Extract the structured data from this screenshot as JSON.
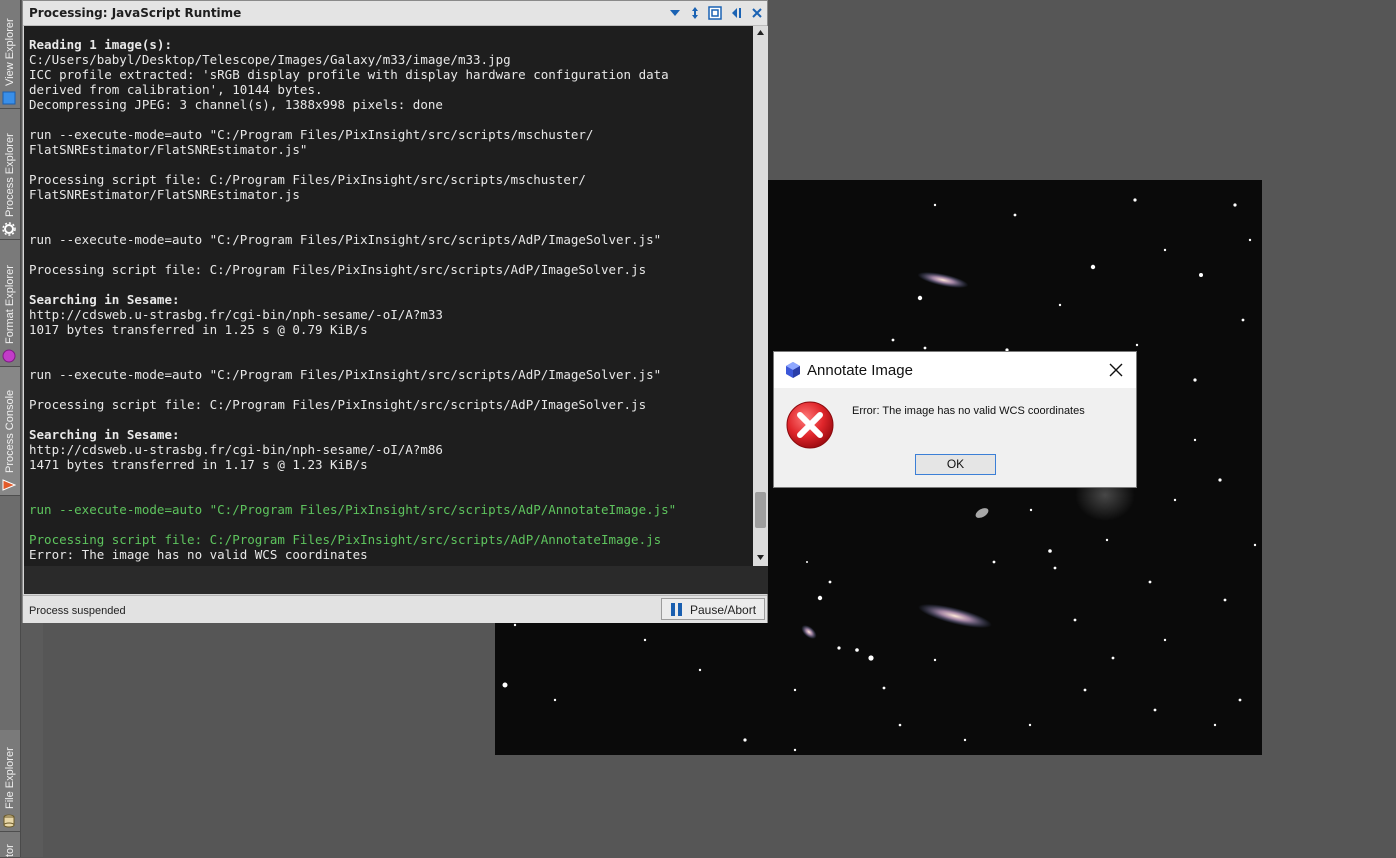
{
  "side_tabs": [
    {
      "label": "View Explorer",
      "icon": "view-explorer-square-icon"
    },
    {
      "label": "Process Explorer",
      "icon": "gear-icon"
    },
    {
      "label": "Format Explorer",
      "icon": "format-circle-icon"
    },
    {
      "label": "Process Console",
      "icon": "console-triangle-icon"
    },
    {
      "label": "File Explorer",
      "icon": "file-cylinder-icon"
    },
    {
      "label": "tor",
      "icon": ""
    }
  ],
  "console": {
    "title": "Processing: JavaScript Runtime",
    "titlebar_icons": [
      "collapse-down-icon",
      "vertical-resize-icon",
      "maximize-icon",
      "dock-left-icon",
      "close-icon"
    ],
    "lines": [
      {
        "text": "Reading 1 image(s):",
        "style": "bold"
      },
      {
        "text": "C:/Users/babyl/Desktop/Telescope/Images/Galaxy/m33/image/m33.jpg",
        "style": ""
      },
      {
        "text": "ICC profile extracted: 'sRGB display profile with display hardware configuration data",
        "style": ""
      },
      {
        "text": "derived from calibration', 10144 bytes.",
        "style": ""
      },
      {
        "text": "Decompressing JPEG: 3 channel(s), 1388x998 pixels: done",
        "style": ""
      },
      {
        "text": "",
        "style": ""
      },
      {
        "text": "run --execute-mode=auto \"C:/Program Files/PixInsight/src/scripts/mschuster/",
        "style": ""
      },
      {
        "text": "FlatSNREstimator/FlatSNREstimator.js\"",
        "style": ""
      },
      {
        "text": "",
        "style": ""
      },
      {
        "text": "Processing script file: C:/Program Files/PixInsight/src/scripts/mschuster/",
        "style": ""
      },
      {
        "text": "FlatSNREstimator/FlatSNREstimator.js",
        "style": ""
      },
      {
        "text": "",
        "style": ""
      },
      {
        "text": "",
        "style": ""
      },
      {
        "text": "run --execute-mode=auto \"C:/Program Files/PixInsight/src/scripts/AdP/ImageSolver.js\"",
        "style": ""
      },
      {
        "text": "",
        "style": ""
      },
      {
        "text": "Processing script file: C:/Program Files/PixInsight/src/scripts/AdP/ImageSolver.js",
        "style": ""
      },
      {
        "text": "",
        "style": ""
      },
      {
        "text": "Searching in Sesame:",
        "style": "bold"
      },
      {
        "text": "http://cdsweb.u-strasbg.fr/cgi-bin/nph-sesame/-oI/A?m33",
        "style": ""
      },
      {
        "text": "1017 bytes transferred in 1.25 s @ 0.79 KiB/s",
        "style": ""
      },
      {
        "text": "",
        "style": ""
      },
      {
        "text": "",
        "style": ""
      },
      {
        "text": "run --execute-mode=auto \"C:/Program Files/PixInsight/src/scripts/AdP/ImageSolver.js\"",
        "style": ""
      },
      {
        "text": "",
        "style": ""
      },
      {
        "text": "Processing script file: C:/Program Files/PixInsight/src/scripts/AdP/ImageSolver.js",
        "style": ""
      },
      {
        "text": "",
        "style": ""
      },
      {
        "text": "Searching in Sesame:",
        "style": "bold"
      },
      {
        "text": "http://cdsweb.u-strasbg.fr/cgi-bin/nph-sesame/-oI/A?m86",
        "style": ""
      },
      {
        "text": "1471 bytes transferred in 1.17 s @ 1.23 KiB/s",
        "style": ""
      },
      {
        "text": "",
        "style": ""
      },
      {
        "text": "",
        "style": ""
      },
      {
        "text": "run --execute-mode=auto \"C:/Program Files/PixInsight/src/scripts/AdP/AnnotateImage.js\"",
        "style": "green"
      },
      {
        "text": "",
        "style": ""
      },
      {
        "text": "Processing script file: C:/Program Files/PixInsight/src/scripts/AdP/AnnotateImage.js",
        "style": "green"
      },
      {
        "text": "Error: The image has no valid WCS coordinates",
        "style": ""
      }
    ],
    "status": "Process suspended",
    "pause_button_label": "Pause/Abort",
    "pause_icon": "pause-icon"
  },
  "dialog": {
    "title": "Annotate Image",
    "app_icon": "pixinsight-logo-icon",
    "close_icon": "close-icon",
    "error_icon": "error-x-icon",
    "message": "Error: The image has no valid WCS coordinates",
    "ok_label": "OK"
  },
  "colors": {
    "console_bg": "#1e1e1e",
    "console_text": "#e8e8e8",
    "console_green": "#5ec45e",
    "workspace_bg": "#565656",
    "error_red": "#e0262b",
    "focus_blue": "#3c7fd6"
  }
}
